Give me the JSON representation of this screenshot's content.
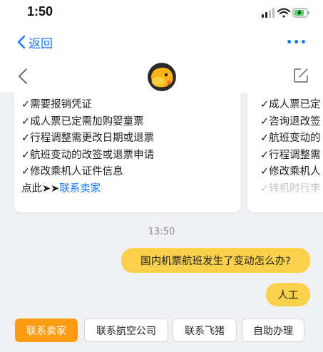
{
  "status_bar": {
    "time": "1:50"
  },
  "nav": {
    "back_label": "返回",
    "more_label": "•••"
  },
  "card_primary": {
    "lines": [
      "✓需要报销凭证",
      "✓成人票已定需加购婴童票",
      "✓行程调整需更改日期或退票",
      "✓航班变动的改签或退票申请",
      "✓修改乘机人证件信息"
    ],
    "contact_prefix": "点此➤➤",
    "contact_link": "联系卖家"
  },
  "card_secondary": {
    "lines": [
      "✓成人票已定",
      "✓咨询退改签",
      "✓航班变动的",
      "✓行程调整需",
      "✓修改乘机人",
      "✓转机时行李"
    ]
  },
  "timestamp": "13:50",
  "messages": [
    {
      "text": "国内机票航班发生了变动怎么办?"
    },
    {
      "text": "人工"
    }
  ],
  "quick_replies": [
    "联系卖家",
    "联系航空公司",
    "联系飞猪",
    "自助办理"
  ],
  "colors": {
    "accent_blue": "#1479ff",
    "bubble_yellow": "#fbd14b",
    "chip_orange": "#ff9d12"
  }
}
